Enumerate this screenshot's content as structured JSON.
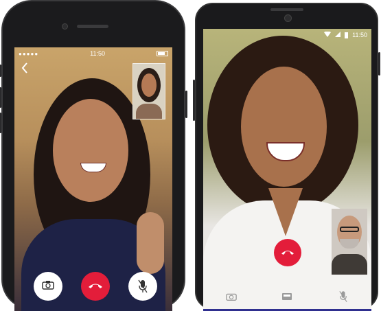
{
  "iphone": {
    "status": {
      "signal": "●●●●●",
      "time": "11:50"
    },
    "icons": {
      "back": "chevron-left-icon",
      "camera_switch": "camera-switch-icon",
      "end_call": "phone-hangup-icon",
      "mute": "mic-off-icon"
    },
    "colors": {
      "end_call": "#e31d3a",
      "button": "#ffffff"
    }
  },
  "android": {
    "status": {
      "time": "11:50"
    },
    "icons": {
      "end_call": "phone-hangup-icon",
      "camera_switch": "camera-switch-icon",
      "video_off": "video-off-icon",
      "mute": "mic-off-icon"
    },
    "colors": {
      "end_call": "#e31d3a",
      "nav": "#2f2f8f"
    }
  }
}
